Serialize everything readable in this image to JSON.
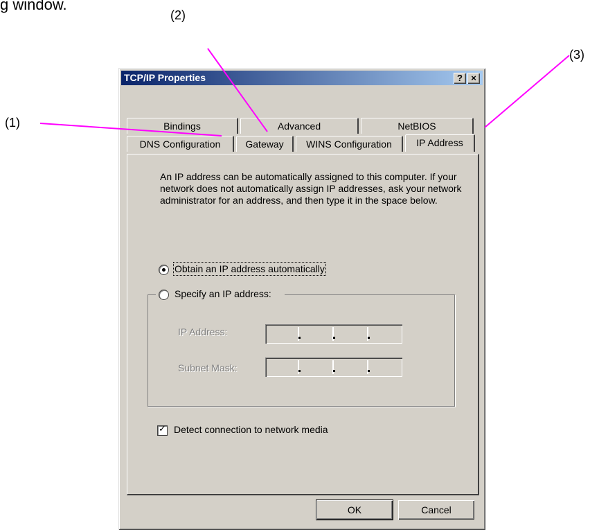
{
  "document": {
    "heading_fragment": "g window."
  },
  "callouts": [
    "(1)",
    "(2)",
    "(3)"
  ],
  "colors": {
    "callout_line": "#ff00ff",
    "title_bar": "#0a246a",
    "dialog_face": "#d4d0c8"
  },
  "dialog": {
    "title": "TCP/IP Properties",
    "help_button": "?",
    "close_button": "×",
    "tabs_back": [
      "Bindings",
      "Advanced",
      "NetBIOS"
    ],
    "tabs_front": [
      "DNS Configuration",
      "Gateway",
      "WINS Configuration",
      "IP Address"
    ],
    "active_tab": "IP Address",
    "description": "An IP address can be automatically assigned to this computer. If your network does not automatically assign IP addresses, ask your network administrator for an address, and then type it in the space below.",
    "radio_auto": {
      "label": "Obtain an IP address automatically",
      "checked": true
    },
    "radio_specify": {
      "label": "Specify an IP address:",
      "checked": false
    },
    "ip_address_label": "IP Address:",
    "subnet_mask_label": "Subnet Mask:",
    "detect_checkbox": {
      "label": "Detect connection to network media",
      "checked": true
    },
    "ok_button": "OK",
    "cancel_button": "Cancel"
  }
}
